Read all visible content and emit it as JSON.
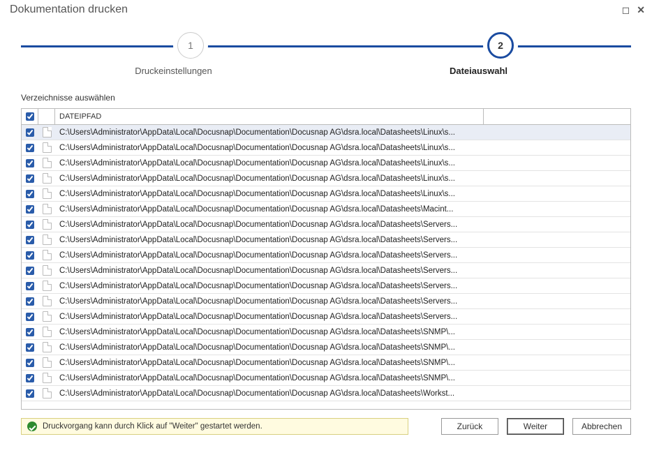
{
  "window": {
    "title": "Dokumentation drucken"
  },
  "stepper": {
    "step1_num": "1",
    "step2_num": "2",
    "step1_label": "Druckeinstellungen",
    "step2_label": "Dateiauswahl",
    "active_step": 2
  },
  "section": {
    "label": "Verzeichnisse auswählen"
  },
  "table": {
    "header": "DATEIPFAD",
    "header_checked": true,
    "rows": [
      {
        "checked": true,
        "selected": true,
        "path": "C:\\Users\\Administrator\\AppData\\Local\\Docusnap\\Documentation\\Docusnap AG\\dsra.local\\Datasheets\\Linux\\s..."
      },
      {
        "checked": true,
        "selected": false,
        "path": "C:\\Users\\Administrator\\AppData\\Local\\Docusnap\\Documentation\\Docusnap AG\\dsra.local\\Datasheets\\Linux\\s..."
      },
      {
        "checked": true,
        "selected": false,
        "path": "C:\\Users\\Administrator\\AppData\\Local\\Docusnap\\Documentation\\Docusnap AG\\dsra.local\\Datasheets\\Linux\\s..."
      },
      {
        "checked": true,
        "selected": false,
        "path": "C:\\Users\\Administrator\\AppData\\Local\\Docusnap\\Documentation\\Docusnap AG\\dsra.local\\Datasheets\\Linux\\s..."
      },
      {
        "checked": true,
        "selected": false,
        "path": "C:\\Users\\Administrator\\AppData\\Local\\Docusnap\\Documentation\\Docusnap AG\\dsra.local\\Datasheets\\Linux\\s..."
      },
      {
        "checked": true,
        "selected": false,
        "path": "C:\\Users\\Administrator\\AppData\\Local\\Docusnap\\Documentation\\Docusnap AG\\dsra.local\\Datasheets\\Macint..."
      },
      {
        "checked": true,
        "selected": false,
        "path": "C:\\Users\\Administrator\\AppData\\Local\\Docusnap\\Documentation\\Docusnap AG\\dsra.local\\Datasheets\\Servers..."
      },
      {
        "checked": true,
        "selected": false,
        "path": "C:\\Users\\Administrator\\AppData\\Local\\Docusnap\\Documentation\\Docusnap AG\\dsra.local\\Datasheets\\Servers..."
      },
      {
        "checked": true,
        "selected": false,
        "path": "C:\\Users\\Administrator\\AppData\\Local\\Docusnap\\Documentation\\Docusnap AG\\dsra.local\\Datasheets\\Servers..."
      },
      {
        "checked": true,
        "selected": false,
        "path": "C:\\Users\\Administrator\\AppData\\Local\\Docusnap\\Documentation\\Docusnap AG\\dsra.local\\Datasheets\\Servers..."
      },
      {
        "checked": true,
        "selected": false,
        "path": "C:\\Users\\Administrator\\AppData\\Local\\Docusnap\\Documentation\\Docusnap AG\\dsra.local\\Datasheets\\Servers..."
      },
      {
        "checked": true,
        "selected": false,
        "path": "C:\\Users\\Administrator\\AppData\\Local\\Docusnap\\Documentation\\Docusnap AG\\dsra.local\\Datasheets\\Servers..."
      },
      {
        "checked": true,
        "selected": false,
        "path": "C:\\Users\\Administrator\\AppData\\Local\\Docusnap\\Documentation\\Docusnap AG\\dsra.local\\Datasheets\\Servers..."
      },
      {
        "checked": true,
        "selected": false,
        "path": "C:\\Users\\Administrator\\AppData\\Local\\Docusnap\\Documentation\\Docusnap AG\\dsra.local\\Datasheets\\SNMP\\..."
      },
      {
        "checked": true,
        "selected": false,
        "path": "C:\\Users\\Administrator\\AppData\\Local\\Docusnap\\Documentation\\Docusnap AG\\dsra.local\\Datasheets\\SNMP\\..."
      },
      {
        "checked": true,
        "selected": false,
        "path": "C:\\Users\\Administrator\\AppData\\Local\\Docusnap\\Documentation\\Docusnap AG\\dsra.local\\Datasheets\\SNMP\\..."
      },
      {
        "checked": true,
        "selected": false,
        "path": "C:\\Users\\Administrator\\AppData\\Local\\Docusnap\\Documentation\\Docusnap AG\\dsra.local\\Datasheets\\SNMP\\..."
      },
      {
        "checked": true,
        "selected": false,
        "path": "C:\\Users\\Administrator\\AppData\\Local\\Docusnap\\Documentation\\Docusnap AG\\dsra.local\\Datasheets\\Workst..."
      }
    ]
  },
  "status": {
    "text": "Druckvorgang kann durch Klick auf \"Weiter\" gestartet werden."
  },
  "buttons": {
    "back": "Zurück",
    "next": "Weiter",
    "cancel": "Abbrechen"
  }
}
